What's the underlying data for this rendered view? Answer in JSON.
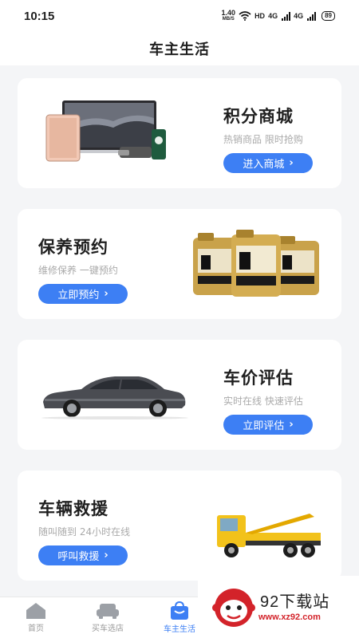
{
  "status_bar": {
    "time": "10:15",
    "net_speed_value": "1.40",
    "net_speed_unit": "MB/S",
    "hd_label": "HD",
    "signal1": "4G",
    "signal2": "4G",
    "battery": "89"
  },
  "header": {
    "title": "车主生活"
  },
  "cards": [
    {
      "title": "积分商城",
      "subtitle": "热销商品 限时抢购",
      "button": "进入商城",
      "icon": "electronics-products-image"
    },
    {
      "title": "保养预约",
      "subtitle": "维修保养 一键预约",
      "button": "立即预约",
      "icon": "motor-oil-bottles-image"
    },
    {
      "title": "车价评估",
      "subtitle": "实时在线 快速评估",
      "button": "立即评估",
      "icon": "sedan-car-image"
    },
    {
      "title": "车辆救援",
      "subtitle": "随叫随到 24小时在线",
      "button": "呼叫救援",
      "icon": "tow-truck-image"
    }
  ],
  "tabbar": {
    "items": [
      {
        "label": "首页",
        "icon": "home-icon"
      },
      {
        "label": "买车选店",
        "icon": "car-icon"
      },
      {
        "label": "车主生活",
        "icon": "bag-icon",
        "active": true
      }
    ]
  },
  "watermark": {
    "text": "92下载站",
    "url": "www.xz92.com"
  },
  "colors": {
    "accent": "#3d7ff4",
    "background": "#f4f5f7",
    "watermark_red": "#d3232a"
  }
}
